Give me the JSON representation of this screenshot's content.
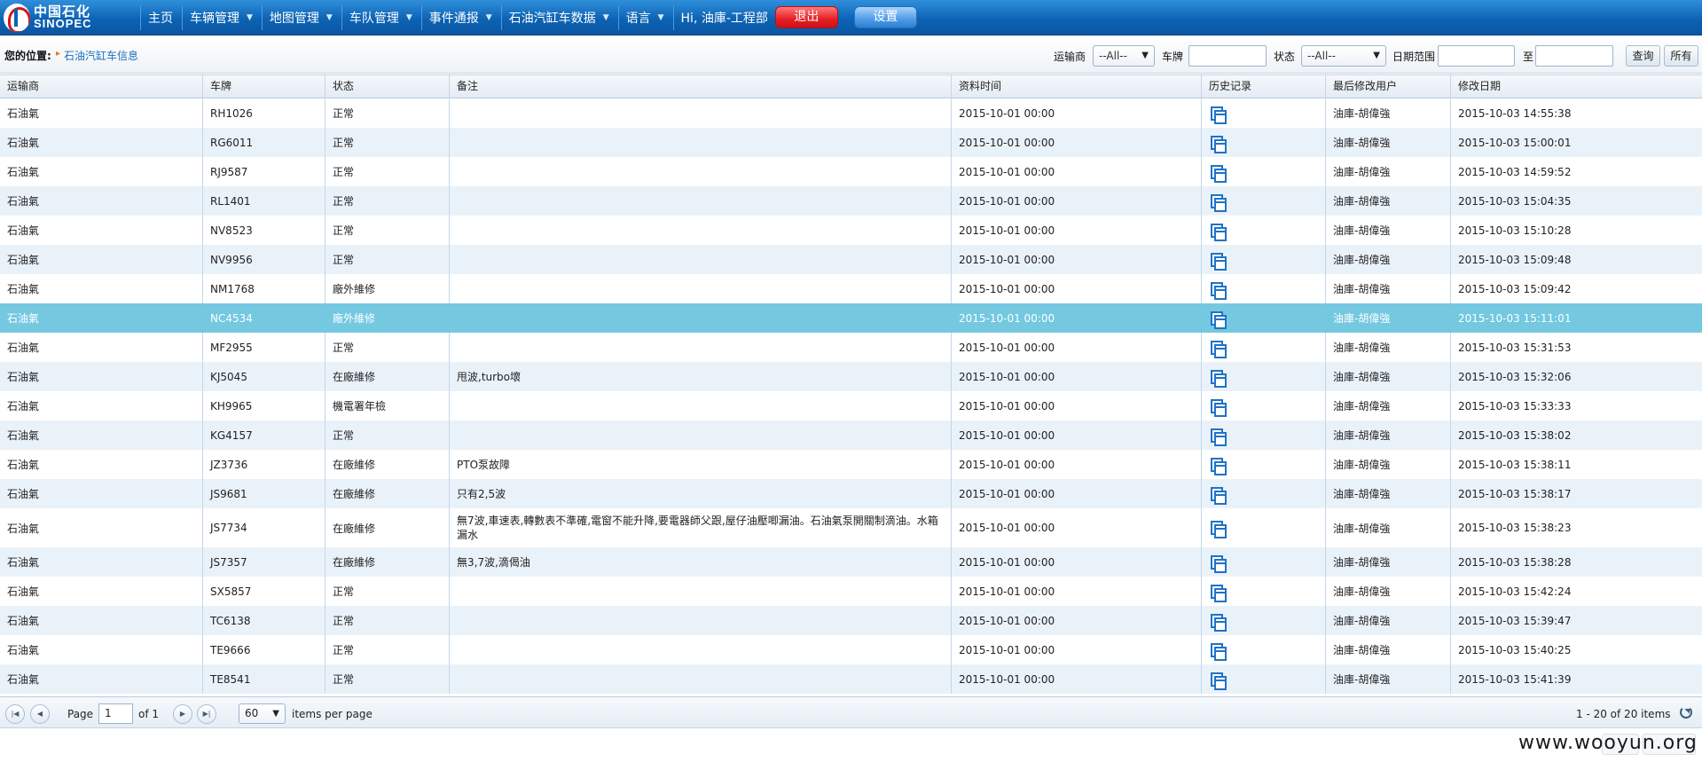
{
  "brand": {
    "cn": "中国石化",
    "en": "SINOPEC"
  },
  "nav": {
    "items": [
      {
        "label": "主页",
        "dropdown": false
      },
      {
        "label": "车辆管理",
        "dropdown": true
      },
      {
        "label": "地图管理",
        "dropdown": true
      },
      {
        "label": "车队管理",
        "dropdown": true
      },
      {
        "label": "事件通报",
        "dropdown": true
      },
      {
        "label": "石油汽缸车数据",
        "dropdown": true
      },
      {
        "label": "语言",
        "dropdown": true
      }
    ],
    "greeting": "Hi, 油庫-工程部",
    "logout_label": "退出",
    "settings_label": "设置"
  },
  "breadcrumb": {
    "label": "您的位置:",
    "current": "石油汽缸车信息"
  },
  "filters": {
    "carrier_label": "运输商",
    "carrier_value": "--All--",
    "plate_label": "车牌",
    "plate_value": "",
    "status_label": "状态",
    "status_value": "--All--",
    "date_label": "日期范围",
    "date_from": "",
    "date_to_label": "至",
    "date_to": "",
    "search_label": "查询",
    "all_label": "所有"
  },
  "grid": {
    "headers": [
      "运输商",
      "车牌",
      "状态",
      "备注",
      "资料时间",
      "历史记录",
      "最后修改用户",
      "修改日期"
    ],
    "rows": [
      {
        "carrier": "石油氣",
        "plate": "RH1026",
        "status": "正常",
        "note": "",
        "time": "2015-10-01 00:00",
        "user": "油庫-胡偉強",
        "modified": "2015-10-03 14:55:38"
      },
      {
        "carrier": "石油氣",
        "plate": "RG6011",
        "status": "正常",
        "note": "",
        "time": "2015-10-01 00:00",
        "user": "油庫-胡偉強",
        "modified": "2015-10-03 15:00:01"
      },
      {
        "carrier": "石油氣",
        "plate": "RJ9587",
        "status": "正常",
        "note": "",
        "time": "2015-10-01 00:00",
        "user": "油庫-胡偉強",
        "modified": "2015-10-03 14:59:52"
      },
      {
        "carrier": "石油氣",
        "plate": "RL1401",
        "status": "正常",
        "note": "",
        "time": "2015-10-01 00:00",
        "user": "油庫-胡偉強",
        "modified": "2015-10-03 15:04:35"
      },
      {
        "carrier": "石油氣",
        "plate": "NV8523",
        "status": "正常",
        "note": "",
        "time": "2015-10-01 00:00",
        "user": "油庫-胡偉強",
        "modified": "2015-10-03 15:10:28"
      },
      {
        "carrier": "石油氣",
        "plate": "NV9956",
        "status": "正常",
        "note": "",
        "time": "2015-10-01 00:00",
        "user": "油庫-胡偉強",
        "modified": "2015-10-03 15:09:48"
      },
      {
        "carrier": "石油氣",
        "plate": "NM1768",
        "status": "廠外維修",
        "note": "",
        "time": "2015-10-01 00:00",
        "user": "油庫-胡偉強",
        "modified": "2015-10-03 15:09:42"
      },
      {
        "carrier": "石油氣",
        "plate": "NC4534",
        "status": "廠外維修",
        "note": "",
        "time": "2015-10-01 00:00",
        "user": "油庫-胡偉強",
        "modified": "2015-10-03 15:11:01",
        "selected": true
      },
      {
        "carrier": "石油氣",
        "plate": "MF2955",
        "status": "正常",
        "note": "",
        "time": "2015-10-01 00:00",
        "user": "油庫-胡偉強",
        "modified": "2015-10-03 15:31:53"
      },
      {
        "carrier": "石油氣",
        "plate": "KJ5045",
        "status": "在廠維修",
        "note": "甩波,turbo壞",
        "time": "2015-10-01 00:00",
        "user": "油庫-胡偉強",
        "modified": "2015-10-03 15:32:06"
      },
      {
        "carrier": "石油氣",
        "plate": "KH9965",
        "status": "機電署年檢",
        "note": "",
        "time": "2015-10-01 00:00",
        "user": "油庫-胡偉強",
        "modified": "2015-10-03 15:33:33"
      },
      {
        "carrier": "石油氣",
        "plate": "KG4157",
        "status": "正常",
        "note": "",
        "time": "2015-10-01 00:00",
        "user": "油庫-胡偉強",
        "modified": "2015-10-03 15:38:02"
      },
      {
        "carrier": "石油氣",
        "plate": "JZ3736",
        "status": "在廠維修",
        "note": "PTO泵故障",
        "time": "2015-10-01 00:00",
        "user": "油庫-胡偉強",
        "modified": "2015-10-03 15:38:11"
      },
      {
        "carrier": "石油氣",
        "plate": "JS9681",
        "status": "在廠維修",
        "note": "只有2,5波",
        "time": "2015-10-01 00:00",
        "user": "油庫-胡偉強",
        "modified": "2015-10-03 15:38:17"
      },
      {
        "carrier": "石油氣",
        "plate": "JS7734",
        "status": "在廠維修",
        "note": "無7波,車速表,轉數表不準確,電窗不能升降,要電器師父跟,屋仔油壓唧漏油。石油氣泵開關制滴油。水箱漏水",
        "time": "2015-10-01 00:00",
        "user": "油庫-胡偉強",
        "modified": "2015-10-03 15:38:23",
        "tall": true
      },
      {
        "carrier": "石油氣",
        "plate": "JS7357",
        "status": "在廠維修",
        "note": "無3,7波,滴偈油",
        "time": "2015-10-01 00:00",
        "user": "油庫-胡偉強",
        "modified": "2015-10-03 15:38:28"
      },
      {
        "carrier": "石油氣",
        "plate": "SX5857",
        "status": "正常",
        "note": "",
        "time": "2015-10-01 00:00",
        "user": "油庫-胡偉強",
        "modified": "2015-10-03 15:42:24"
      },
      {
        "carrier": "石油氣",
        "plate": "TC6138",
        "status": "正常",
        "note": "",
        "time": "2015-10-01 00:00",
        "user": "油庫-胡偉強",
        "modified": "2015-10-03 15:39:47"
      },
      {
        "carrier": "石油氣",
        "plate": "TE9666",
        "status": "正常",
        "note": "",
        "time": "2015-10-01 00:00",
        "user": "油庫-胡偉強",
        "modified": "2015-10-03 15:40:25"
      },
      {
        "carrier": "石油氣",
        "plate": "TE8541",
        "status": "正常",
        "note": "",
        "time": "2015-10-01 00:00",
        "user": "油庫-胡偉強",
        "modified": "2015-10-03 15:41:39"
      }
    ]
  },
  "pager": {
    "page_label": "Page",
    "page_value": "1",
    "of_label": "of 1",
    "page_size": "60",
    "per_page_label": "items per page",
    "summary": "1 - 20 of 20 items"
  },
  "watermark": "www.wooyun.org",
  "colors": {
    "nav_blue": "#0d63b4",
    "selected_row": "#74c8e0",
    "logout_red": "#e71d24",
    "link_blue": "#1d6fc1"
  }
}
